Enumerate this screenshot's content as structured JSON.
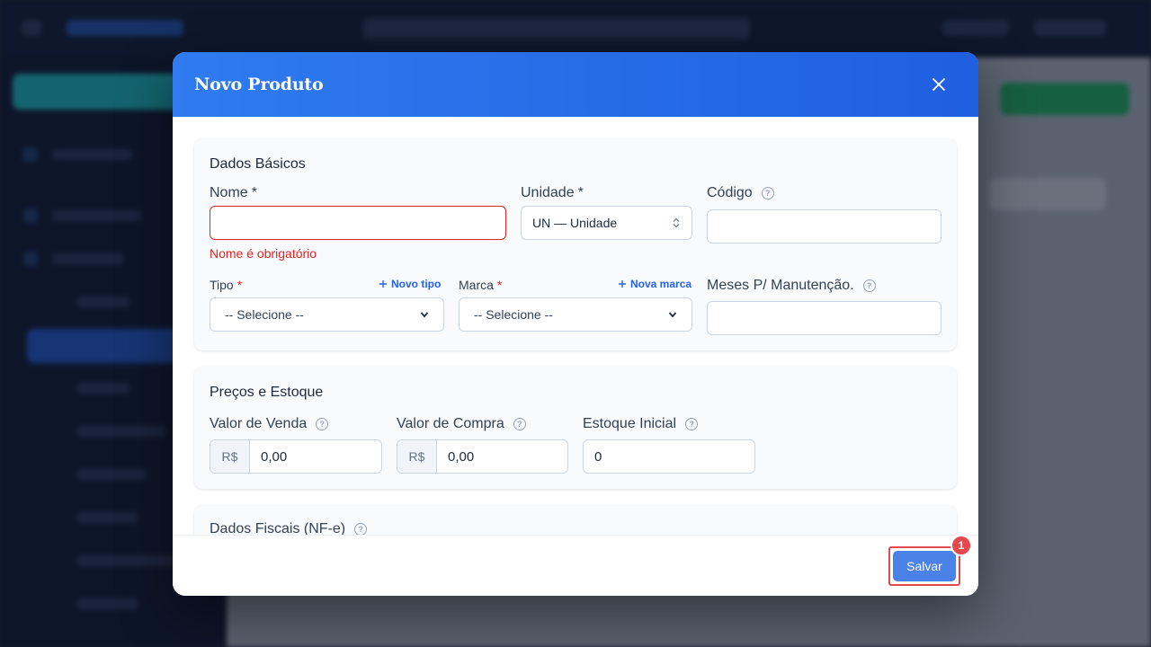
{
  "modal": {
    "title": "Novo Produto",
    "close_icon": "close-icon"
  },
  "basic": {
    "title": "Dados Básicos",
    "nome": {
      "label": "Nome",
      "required_mark": "*",
      "value": "",
      "error": "Nome é obrigatório"
    },
    "unidade": {
      "label": "Unidade",
      "required_mark": "*",
      "selected": "UN — Unidade"
    },
    "codigo": {
      "label": "Código",
      "value": ""
    },
    "tipo": {
      "label": "Tipo",
      "required_mark": "*",
      "selected": "-- Selecione --",
      "add_label": "Novo tipo"
    },
    "marca": {
      "label": "Marca",
      "required_mark": "*",
      "selected": "-- Selecione --",
      "add_label": "Nova marca"
    },
    "meses": {
      "label": "Meses P/ Manutenção.",
      "value": ""
    },
    "help_glyph": "?"
  },
  "prices": {
    "title": "Preços e Estoque",
    "venda": {
      "label": "Valor de Venda",
      "prefix": "R$",
      "value": "0,00"
    },
    "compra": {
      "label": "Valor de Compra",
      "prefix": "R$",
      "value": "0,00"
    },
    "estoque": {
      "label": "Estoque Inicial",
      "value": "0"
    }
  },
  "fiscal": {
    "title": "Dados Fiscais (NF-e)"
  },
  "footer": {
    "save_label": "Salvar",
    "badge": "1"
  },
  "colors": {
    "header_blue": "#2f7bef",
    "error_red": "#dc2626",
    "link_blue": "#2563eb",
    "save_blue": "#4a82e8",
    "badge_red": "#e5484d"
  }
}
